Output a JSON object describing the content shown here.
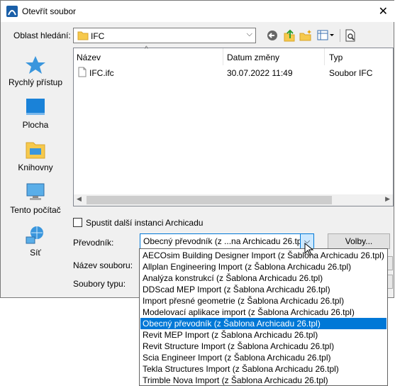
{
  "window": {
    "title": "Otevřít soubor",
    "close_symbol": "✕"
  },
  "lookin": {
    "label": "Oblast hledání:",
    "value": "IFC"
  },
  "places": [
    {
      "label": "Rychlý přístup",
      "icon": "star-icon"
    },
    {
      "label": "Plocha",
      "icon": "desktop-icon"
    },
    {
      "label": "Knihovny",
      "icon": "libraries-icon"
    },
    {
      "label": "Tento počítač",
      "icon": "computer-icon"
    },
    {
      "label": "Síť",
      "icon": "network-icon"
    }
  ],
  "filelist": {
    "columns": [
      "Název",
      "Datum změny",
      "Typ"
    ],
    "rows": [
      {
        "name": "IFC.ifc",
        "date": "30.07.2022 11:49",
        "type": "Soubor IFC"
      }
    ]
  },
  "checkbox": {
    "label": "Spustit další instanci Archicadu",
    "checked": false
  },
  "converter": {
    "label": "Převodník:",
    "value": "Obecný převodník (z ...na Archicadu 26.tpl)",
    "options_button": "Volby...",
    "items": [
      "AECOsim Building Designer Import (z Šablona Archicadu 26.tpl)",
      "Allplan Engineering Import (z Šablona Archicadu 26.tpl)",
      "Analýza konstrukcí (z Šablona Archicadu 26.tpl)",
      "DDScad MEP Import (z Šablona Archicadu 26.tpl)",
      "Import přesné geometrie (z Šablona Archicadu 26.tpl)",
      "Modelovací aplikace import (z Šablona Archicadu 26.tpl)",
      "Obecný převodník (z Šablona Archicadu 26.tpl)",
      "Revit MEP Import (z Šablona Archicadu 26.tpl)",
      "Revit Structure Import (z Šablona Archicadu 26.tpl)",
      "Scia Engineer Import (z Šablona Archicadu 26.tpl)",
      "Tekla Structures Import (z Šablona Archicadu 26.tpl)",
      "Trimble Nova Import (z Šablona Archicadu 26.tpl)"
    ],
    "selected_index": 6
  },
  "filename": {
    "label": "Název souboru:"
  },
  "filetype": {
    "label": "Soubory typu:"
  },
  "colors": {
    "accent": "#0078d7",
    "folder": "#f6c94c"
  }
}
